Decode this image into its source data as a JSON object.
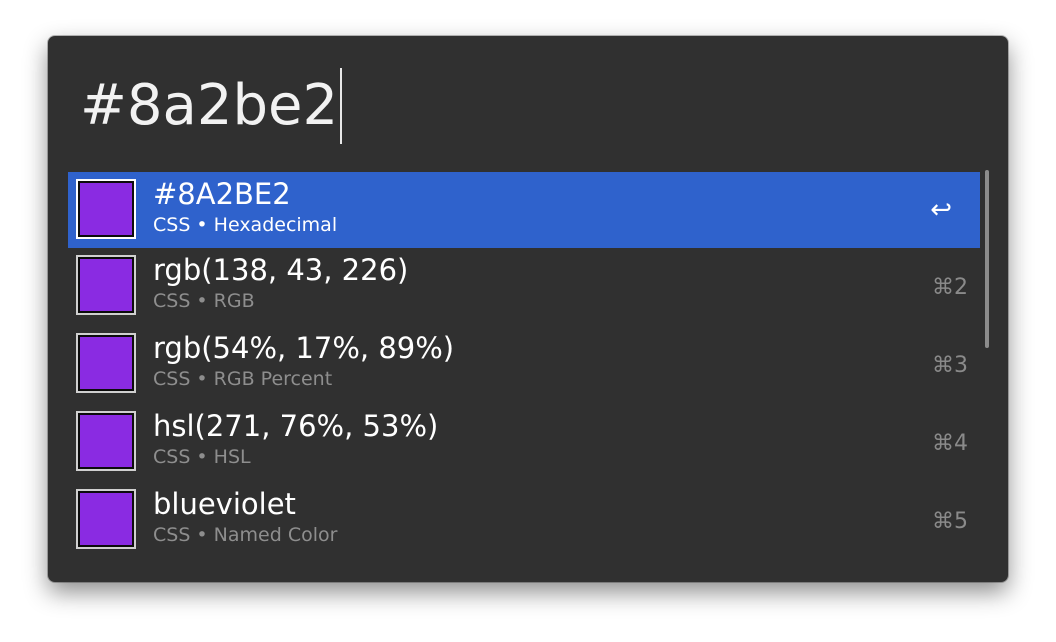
{
  "search": {
    "value": "#8a2be2"
  },
  "results": [
    {
      "title": "#8A2BE2",
      "subtitle": "CSS • Hexadecimal",
      "shortcut": "↩",
      "swatch_color": "#8a2be2"
    },
    {
      "title": "rgb(138, 43, 226)",
      "subtitle": "CSS • RGB",
      "shortcut": "⌘2",
      "swatch_color": "#8a2be2"
    },
    {
      "title": "rgb(54%, 17%, 89%)",
      "subtitle": "CSS • RGB Percent",
      "shortcut": "⌘3",
      "swatch_color": "#8a2be2"
    },
    {
      "title": "hsl(271, 76%, 53%)",
      "subtitle": "CSS • HSL",
      "shortcut": "⌘4",
      "swatch_color": "#8a2be2"
    },
    {
      "title": "blueviolet",
      "subtitle": "CSS • Named Color",
      "shortcut": "⌘5",
      "swatch_color": "#8a2be2"
    }
  ],
  "colors": {
    "window_bg": "#303030",
    "selection": "#2f62cc",
    "swatch": "#8a2be2"
  }
}
